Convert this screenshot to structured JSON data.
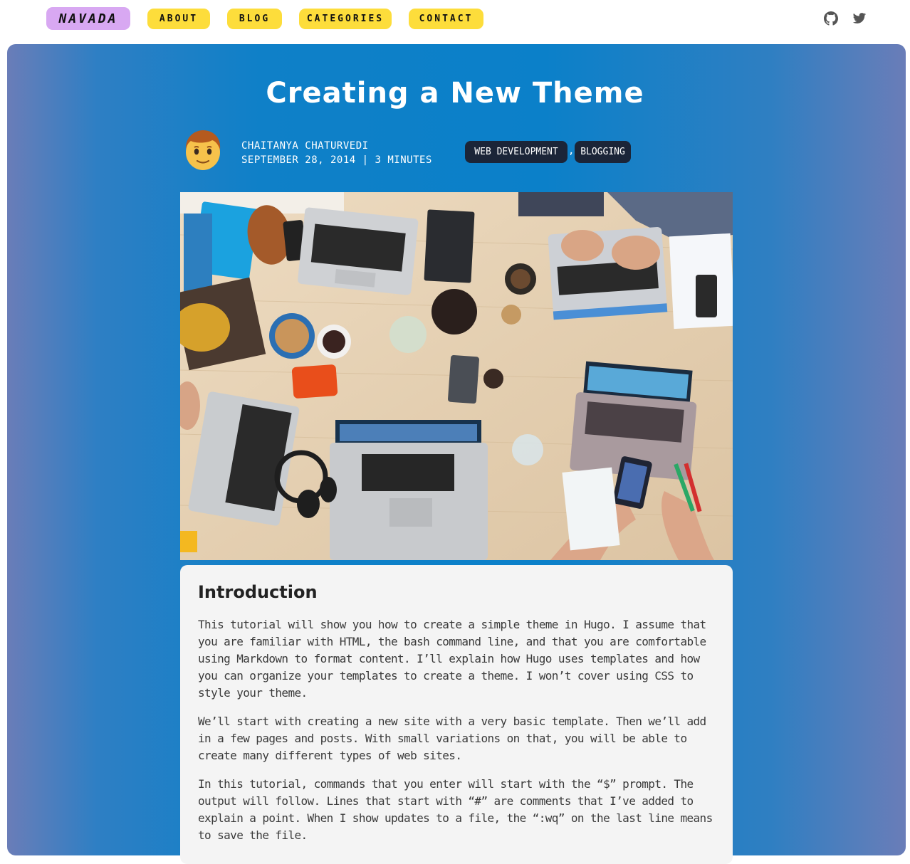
{
  "nav": {
    "brand": "NAVADA",
    "links": [
      "About",
      "Blog",
      "Categories",
      "Contact"
    ],
    "social": [
      "github-icon",
      "twitter-icon"
    ]
  },
  "post": {
    "title": "Creating a New Theme",
    "author": "Chaitanya Chaturvedi",
    "meta": "September 28, 2014 | 3 minutes",
    "tags": [
      "Web Development",
      "Blogging"
    ],
    "tag_separator": ","
  },
  "content": {
    "heading": "Introduction",
    "paragraphs": [
      "This tutorial will show you how to create a simple theme in Hugo. I assume that you are familiar with HTML, the bash command line, and that you are comfortable using Markdown to format content. I’ll explain how Hugo uses templates and how you can organize your templates to create a theme. I won’t cover using CSS to style your theme.",
      "We’ll start with creating a new site with a very basic template. Then we’ll add in a few pages and posts. With small variations on that, you will be able to create many different types of web sites.",
      "In this tutorial, commands that you enter will start with the “$” prompt. The output will follow. Lines that start with “#” are comments that I’ve added to explain a point. When I show updates to a file, the “:wq” on the last line means to save the file."
    ]
  },
  "colors": {
    "brand_bg": "#d8a8f2",
    "nav_bg": "#fddd3b",
    "hero_blue": "#0b80c9",
    "hero_edge": "#6a7db8",
    "tag_bg": "#1b2538",
    "card_bg": "#f4f4f4"
  }
}
